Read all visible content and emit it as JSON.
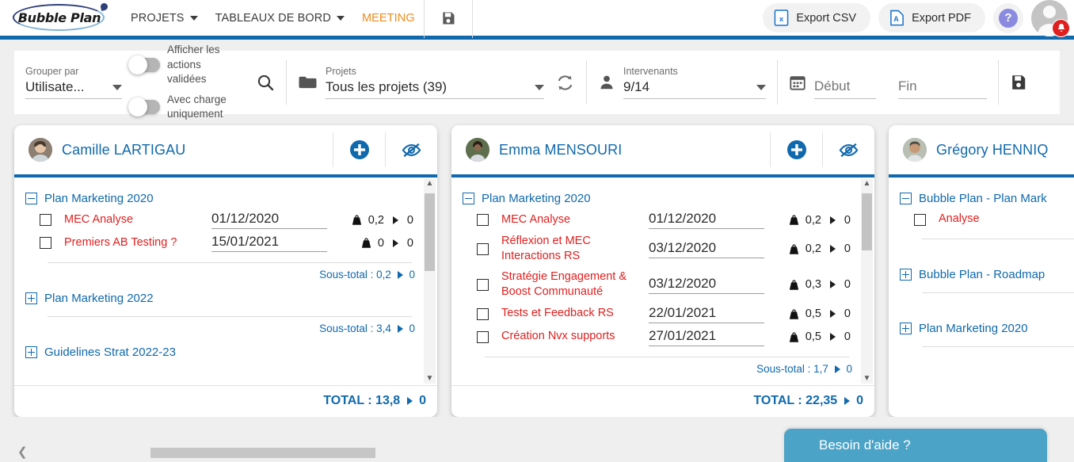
{
  "colors": {
    "brand_blue": "#1069ad",
    "accent_orange": "#f08a1c",
    "task_red": "#e02020",
    "help_widget": "#4ba3c7",
    "badge_red": "#e02020"
  },
  "topnav": {
    "logo_text": "Bubble Plan",
    "items": [
      {
        "label": "PROJETS",
        "has_caret": true,
        "active": false
      },
      {
        "label": "TABLEAUX DE BORD",
        "has_caret": true,
        "active": false
      },
      {
        "label": "MEETING",
        "has_caret": false,
        "active": true
      }
    ],
    "save_icon": "floppy-disk-icon",
    "export_csv": "Export CSV",
    "export_pdf": "Export PDF",
    "help_glyph": "?",
    "avatar_icon": "user-avatar-icon",
    "bell_icon": "bell-icon"
  },
  "filterbar": {
    "group_by_label": "Grouper par",
    "group_by_value": "Utilisate...",
    "toggle_1_label": "Afficher les actions validées",
    "toggle_1_on": false,
    "toggle_2_label": "Avec charge uniquement",
    "toggle_2_on": false,
    "search_icon": "search-icon",
    "projects_label": "Projets",
    "projects_value": "Tous les projets (39)",
    "projects_icon": "folder-icon",
    "refresh_icon": "refresh-icon",
    "stakeholders_label": "Intervenants",
    "stakeholders_value": "9/14",
    "stakeholders_icon": "person-icon",
    "calendar_icon": "calendar-icon",
    "date_start_placeholder": "Début",
    "date_start_value": "",
    "date_end_placeholder": "Fin",
    "date_end_value": "",
    "save_icon": "floppy-disk-icon"
  },
  "cards": [
    {
      "name": "Camille LARTIGAU",
      "add_icon": "plus-circle-icon",
      "hide_icon": "eye-slash-icon",
      "total_label": "TOTAL :",
      "total_value": "13,8",
      "total_second": "0",
      "groups": [
        {
          "title": "Plan Marketing 2020",
          "expanded": true,
          "tasks": [
            {
              "name": "MEC Analyse",
              "date": "01/12/2020",
              "charge": "0,2",
              "second": "0"
            },
            {
              "name": "Premiers AB Testing ?",
              "date": "15/01/2021",
              "charge": "0",
              "second": "0"
            }
          ],
          "subtotal_label": "Sous-total :",
          "subtotal_value": "0,2",
          "subtotal_second": "0"
        },
        {
          "title": "Plan Marketing 2022",
          "expanded": false,
          "tasks": [],
          "subtotal_label": "Sous-total :",
          "subtotal_value": "3,4",
          "subtotal_second": "0"
        },
        {
          "title": "Guidelines Strat 2022-23",
          "expanded": false,
          "tasks": [],
          "subtotal_label": "",
          "subtotal_value": "",
          "subtotal_second": ""
        }
      ]
    },
    {
      "name": "Emma MENSOURI",
      "add_icon": "plus-circle-icon",
      "hide_icon": "eye-slash-icon",
      "total_label": "TOTAL :",
      "total_value": "22,35",
      "total_second": "0",
      "groups": [
        {
          "title": "Plan Marketing 2020",
          "expanded": true,
          "tasks": [
            {
              "name": "MEC Analyse",
              "date": "01/12/2020",
              "charge": "0,2",
              "second": "0"
            },
            {
              "name": "Réflexion et MEC Interactions RS",
              "date": "03/12/2020",
              "charge": "0,2",
              "second": "0"
            },
            {
              "name": "Stratégie Engagement & Boost Communauté",
              "date": "03/12/2020",
              "charge": "0,3",
              "second": "0"
            },
            {
              "name": "Tests et Feedback RS",
              "date": "22/01/2021",
              "charge": "0,5",
              "second": "0"
            },
            {
              "name": "Création Nvx supports",
              "date": "27/01/2021",
              "charge": "0,5",
              "second": "0"
            }
          ],
          "subtotal_label": "Sous-total :",
          "subtotal_value": "1,7",
          "subtotal_second": "0"
        }
      ]
    },
    {
      "name": "Grégory HENNIQ",
      "add_icon": "plus-circle-icon",
      "hide_icon": "eye-slash-icon",
      "total_label": "",
      "total_value": "",
      "total_second": "",
      "groups": [
        {
          "title": "Bubble Plan - Plan Mark",
          "expanded": true,
          "tasks": [
            {
              "name": "Analyse",
              "date": "",
              "charge": "",
              "second": ""
            }
          ],
          "subtotal_label": "",
          "subtotal_value": "",
          "subtotal_second": ""
        },
        {
          "title": "Bubble Plan - Roadmap",
          "expanded": false,
          "tasks": [],
          "subtotal_label": "",
          "subtotal_value": "",
          "subtotal_second": ""
        },
        {
          "title": "Plan Marketing 2020",
          "expanded": false,
          "tasks": [],
          "subtotal_label": "",
          "subtotal_value": "",
          "subtotal_second": ""
        }
      ]
    }
  ],
  "bottom": {
    "left_chevron": "chevron-left-icon",
    "help_widget_label": "Besoin d'aide ?"
  }
}
